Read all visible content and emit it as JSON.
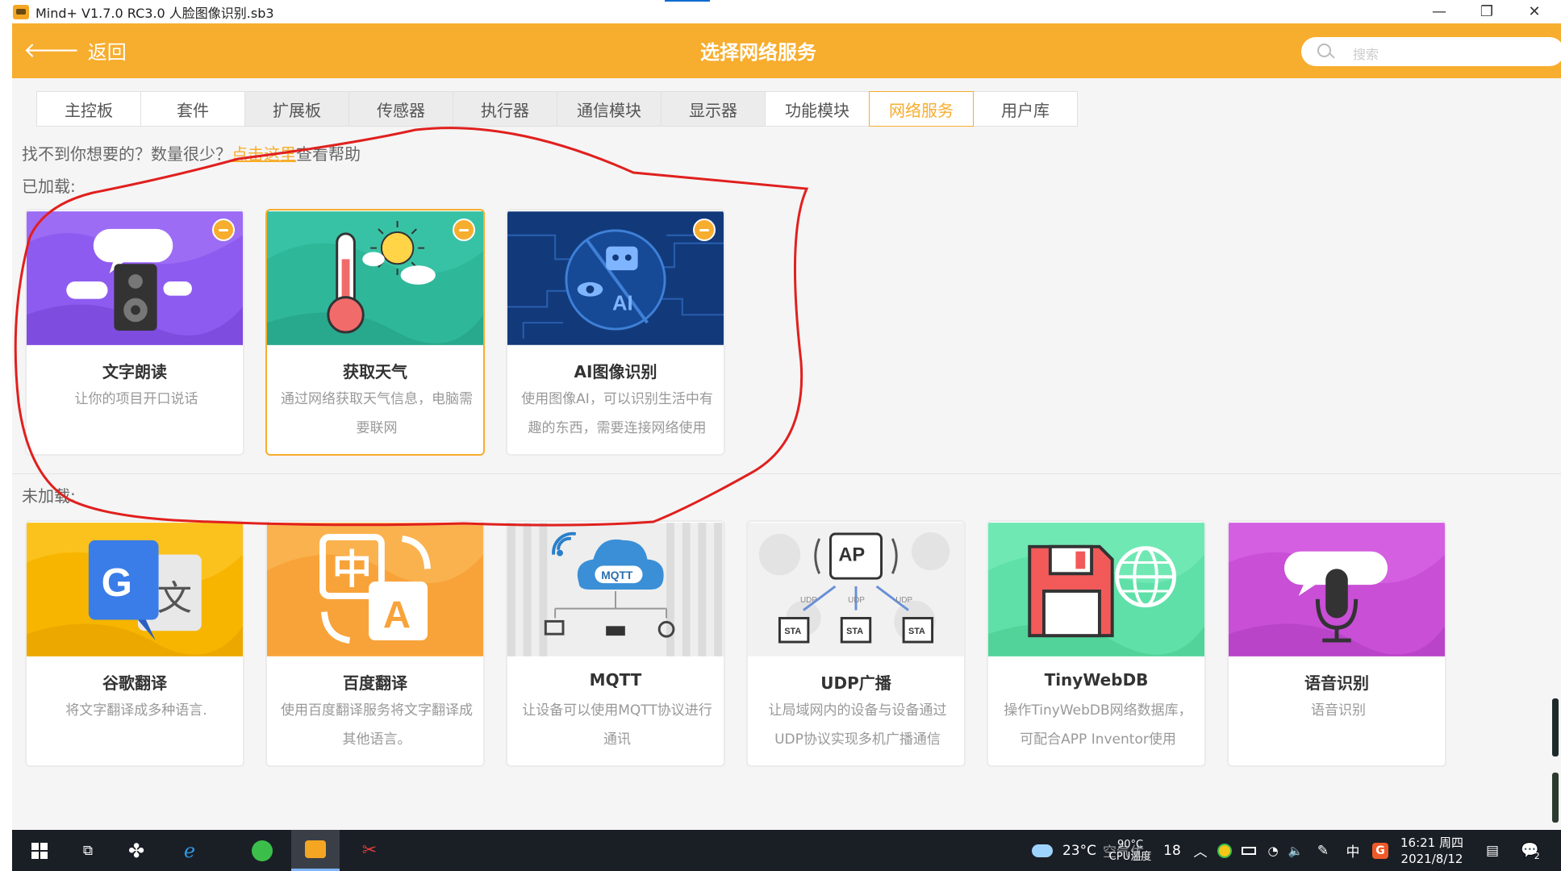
{
  "window": {
    "title": "Mind+ V1.7.0 RC3.0  人脸图像识别.sb3"
  },
  "header": {
    "back_label": "返回",
    "title": "选择网络服务",
    "search_placeholder": "搜索"
  },
  "tabs": [
    {
      "label": "主控板"
    },
    {
      "label": "套件"
    },
    {
      "label": "扩展板"
    },
    {
      "label": "传感器"
    },
    {
      "label": "执行器"
    },
    {
      "label": "通信模块"
    },
    {
      "label": "显示器"
    },
    {
      "label": "功能模块"
    },
    {
      "label": "网络服务"
    },
    {
      "label": "用户库"
    }
  ],
  "hint": {
    "prefix": "找不到你想要的？数量很少？",
    "link": "点击这里",
    "suffix": "查看帮助"
  },
  "loaded": {
    "label": "已加载:",
    "cards": [
      {
        "title": "文字朗读",
        "desc": "让你的项目开口说话"
      },
      {
        "title": "获取天气",
        "desc": "通过网络获取天气信息，电脑需要联网"
      },
      {
        "title": "AI图像识别",
        "desc": "使用图像AI，可以识别生活中有趣的东西，需要连接网络使用",
        "img_text": "AI"
      }
    ]
  },
  "unloaded": {
    "label": "未加载:",
    "cards": [
      {
        "title": "谷歌翻译",
        "desc": "将文字翻译成多种语言.",
        "img_g": "G",
        "img_wen": "文"
      },
      {
        "title": "百度翻译",
        "desc": "使用百度翻译服务将文字翻译成其他语言。",
        "img_zh": "中",
        "img_a": "A"
      },
      {
        "title": "MQTT",
        "desc": "让设备可以使用MQTT协议进行通讯",
        "img_text": "MQTT"
      },
      {
        "title": "UDP广播",
        "desc": "让局域网内的设备与设备通过UDP协议实现多机广播通信",
        "img_ap": "AP",
        "img_udp": "UDP",
        "img_sta": "STA"
      },
      {
        "title": "TinyWebDB",
        "desc": "操作TinyWebDB网络数据库，可配合APP Inventor使用"
      },
      {
        "title": "语音识别",
        "desc": "语音识别"
      }
    ]
  },
  "taskbar": {
    "temperature": "23°C",
    "cpu_temp": "90°C",
    "cpu_label": "CPU温度",
    "aqi_prefix": "空气优",
    "aqi_value": "18",
    "ime": "中",
    "time": "16:21 周四",
    "date": "2021/8/12",
    "notification_count": "2"
  },
  "colors": {
    "accent": "#f7ad2d",
    "annotation": "#e0201e"
  }
}
